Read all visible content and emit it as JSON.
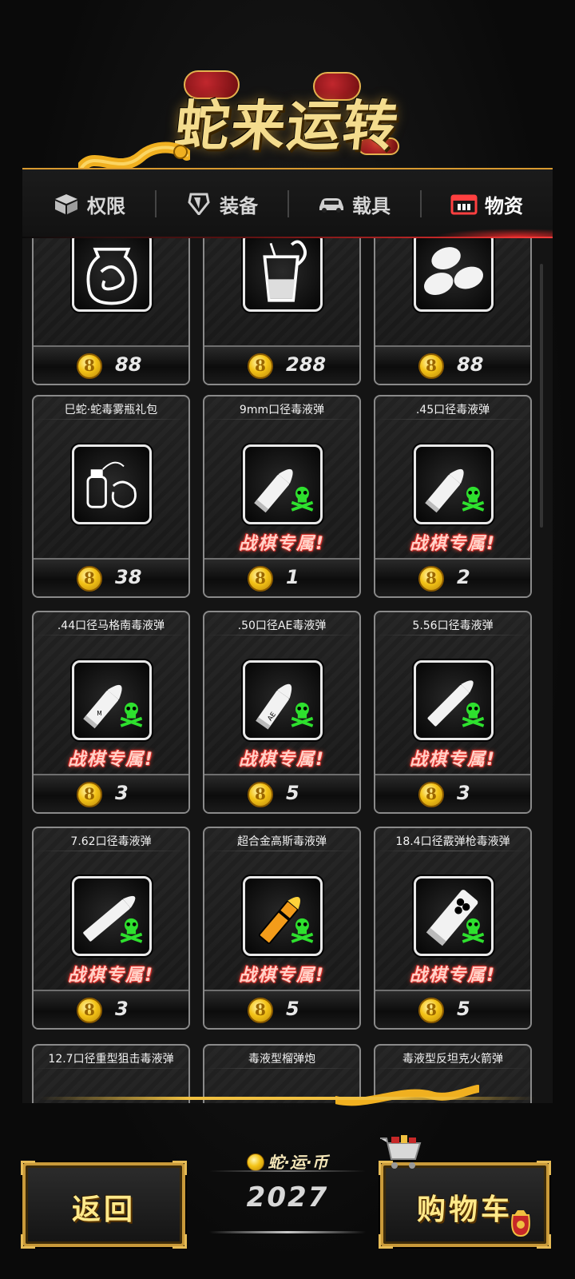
{
  "header": {
    "title": "蛇来运转",
    "tabs": [
      {
        "label": "权限",
        "icon": "box-icon",
        "active": false
      },
      {
        "label": "装备",
        "icon": "armor-icon",
        "active": false
      },
      {
        "label": "载具",
        "icon": "car-icon",
        "active": false
      },
      {
        "label": "物资",
        "icon": "supply-crate-icon",
        "active": true
      }
    ]
  },
  "colors": {
    "accent_gold": "#f0c040",
    "active_red": "#e62828",
    "exclusive_text": "#ffd2c8",
    "poison_green": "#2ee02e"
  },
  "shop": {
    "exclusive_label": "战棋专属!",
    "items": [
      {
        "name": "",
        "icon": "snake-jar-icon",
        "price": "88",
        "exclusive": false
      },
      {
        "name": "",
        "icon": "snake-cup-icon",
        "price": "288",
        "exclusive": false
      },
      {
        "name": "",
        "icon": "eggs-icon",
        "price": "88",
        "exclusive": false
      },
      {
        "name": "巳蛇·蛇毒雾瓶礼包",
        "icon": "poison-grenade-icon",
        "price": "38",
        "exclusive": false
      },
      {
        "name": "9mm口径毒液弹",
        "icon": "bullet-9mm-icon",
        "price": "1",
        "exclusive": true
      },
      {
        "name": ".45口径毒液弹",
        "icon": "bullet-45-icon",
        "price": "2",
        "exclusive": true
      },
      {
        "name": ".44口径马格南毒液弹",
        "icon": "bullet-44-magnum-icon",
        "price": "3",
        "exclusive": true
      },
      {
        "name": ".50口径AE毒液弹",
        "icon": "bullet-50ae-icon",
        "price": "5",
        "exclusive": true
      },
      {
        "name": "5.56口径毒液弹",
        "icon": "bullet-556-icon",
        "price": "3",
        "exclusive": true
      },
      {
        "name": "7.62口径毒液弹",
        "icon": "bullet-762-icon",
        "price": "3",
        "exclusive": true
      },
      {
        "name": "超合金高斯毒液弹",
        "icon": "gauss-bullet-icon",
        "price": "5",
        "exclusive": true
      },
      {
        "name": "18.4口径霰弹枪毒液弹",
        "icon": "shotgun-shell-icon",
        "price": "5",
        "exclusive": true
      },
      {
        "name": "12.7口径重型狙击毒液弹",
        "icon": "",
        "price": "",
        "exclusive": false
      },
      {
        "name": "毒液型榴弹炮",
        "icon": "",
        "price": "",
        "exclusive": false
      },
      {
        "name": "毒液型反坦克火箭弹",
        "icon": "",
        "price": "",
        "exclusive": false
      }
    ]
  },
  "footer": {
    "back_label": "返回",
    "cart_label": "购物车",
    "currency_name": "蛇·运·币",
    "currency_amount": "2027"
  }
}
